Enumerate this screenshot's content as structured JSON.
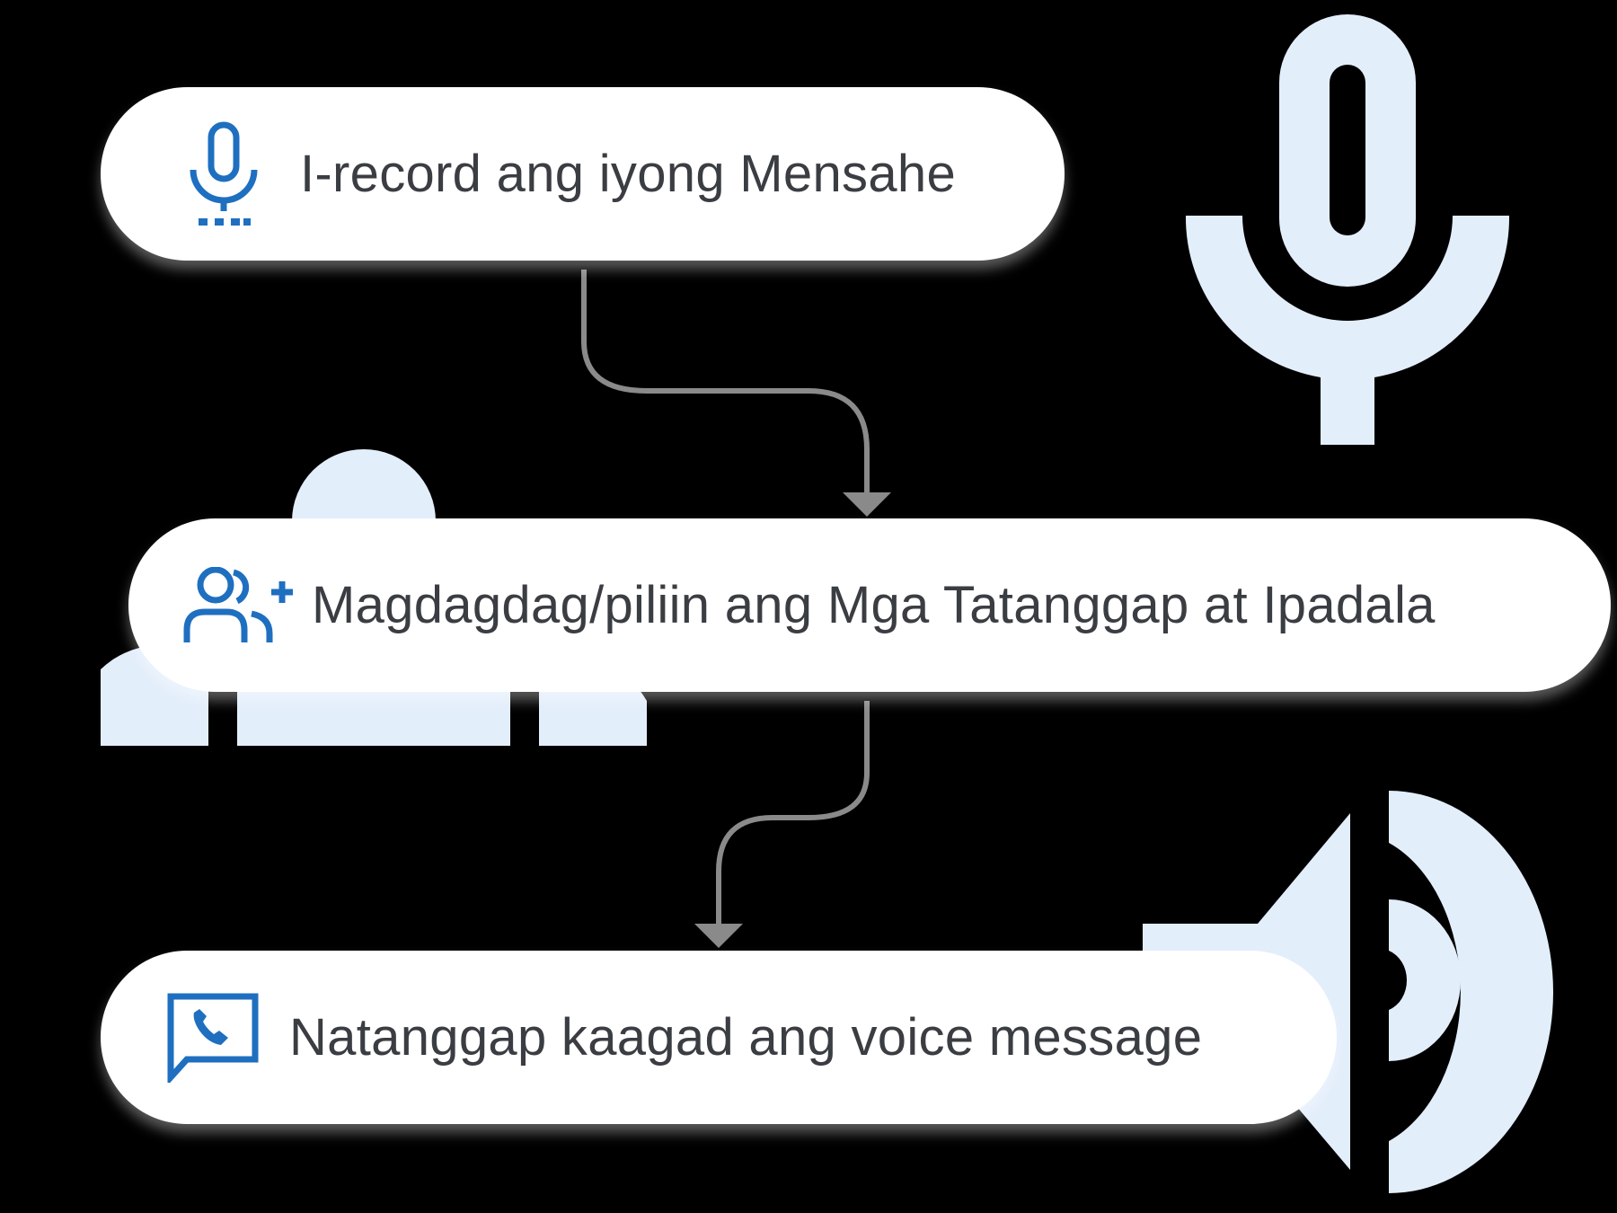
{
  "steps": [
    {
      "label": "I-record ang iyong Mensahe",
      "icon": "microphone-icon"
    },
    {
      "label": "Magdagdag/piliin ang Mga Tatanggap at Ipadala",
      "icon": "add-group-icon"
    },
    {
      "label": "Natanggap kaagad ang voice message",
      "icon": "phone-message-icon"
    }
  ],
  "colors": {
    "background": "#000000",
    "pill": "#ffffff",
    "text": "#3a3d42",
    "icon": "#1f6fc0",
    "decoration": "#e3eefb",
    "connector": "#8a8a8a"
  }
}
